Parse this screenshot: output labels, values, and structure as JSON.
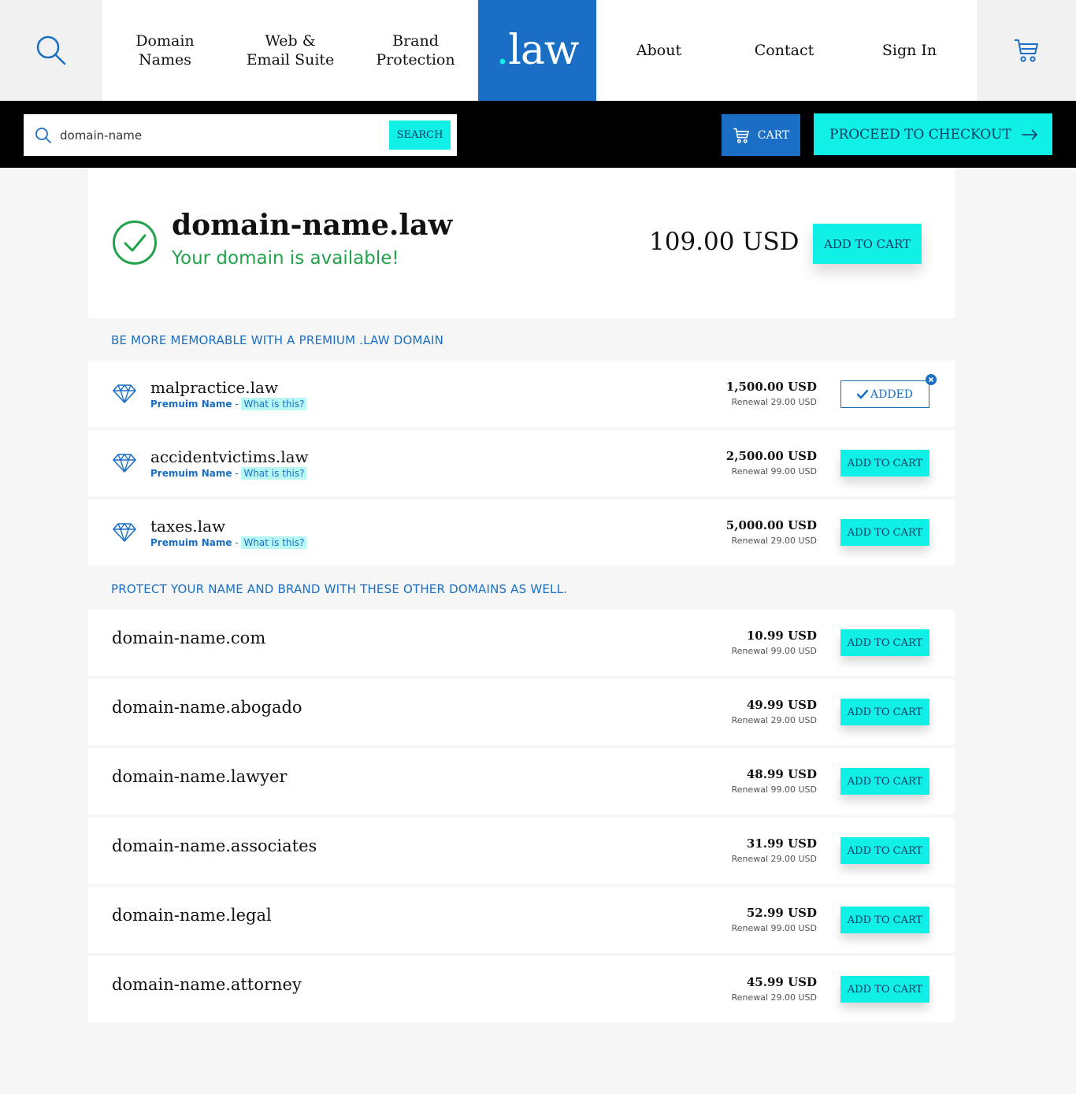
{
  "nav": {
    "items": [
      "Domain\nNames",
      "Web &\nEmail Suite",
      "Brand\nProtection"
    ],
    "logo_dot": ".",
    "logo_text": "law",
    "right_items": [
      "About",
      "Contact",
      "Sign In"
    ]
  },
  "search": {
    "value": "domain-name",
    "button_label": "SEARCH"
  },
  "cart": {
    "label": "CART",
    "checkout_label": "PROCEED TO CHECKOUT"
  },
  "hero": {
    "domain": "domain-name.law",
    "status": "Your domain is available!",
    "price": "109.00 USD",
    "add_label": "ADD TO CART"
  },
  "premium": {
    "heading": "BE MORE MEMORABLE WITH A PREMIUM .LAW DOMAIN",
    "tag_label": "Premuim Name",
    "tag_sep": " - ",
    "tag_link": "What is this?",
    "items": [
      {
        "name": "malpractice.law",
        "price": "1,500.00 USD",
        "renewal": "Renewal 29.00 USD",
        "button": "ADDED"
      },
      {
        "name": "accidentvictims.law",
        "price": "2,500.00 USD",
        "renewal": "Renewal 99.00 USD",
        "button": "ADD TO CART"
      },
      {
        "name": "taxes.law",
        "price": "5,000.00 USD",
        "renewal": "Renewal 29.00 USD",
        "button": "ADD TO CART"
      }
    ]
  },
  "other": {
    "heading": "PROTECT YOUR NAME AND BRAND WITH THESE OTHER DOMAINS AS WELL.",
    "items": [
      {
        "name": "domain-name.com",
        "price": "10.99 USD",
        "renewal": "Renewal 99.00 USD",
        "button": "ADD TO CART"
      },
      {
        "name": "domain-name.abogado",
        "price": "49.99 USD",
        "renewal": "Renewal 29.00 USD",
        "button": "ADD TO CART"
      },
      {
        "name": "domain-name.lawyer",
        "price": "48.99 USD",
        "renewal": "Renewal 99.00 USD",
        "button": "ADD TO CART"
      },
      {
        "name": "domain-name.associates",
        "price": "31.99 USD",
        "renewal": "Renewal 29.00 USD",
        "button": "ADD TO CART"
      },
      {
        "name": "domain-name.legal",
        "price": "52.99 USD",
        "renewal": "Renewal 99.00 USD",
        "button": "ADD TO CART"
      },
      {
        "name": "domain-name.attorney",
        "price": "45.99 USD",
        "renewal": "Renewal 29.00 USD",
        "button": "ADD TO CART"
      }
    ]
  },
  "colors": {
    "primary_blue": "#1a6fc4",
    "accent_cyan": "#10f0e6",
    "success_green": "#22a24a"
  },
  "icons": [
    "search-icon",
    "cart-icon",
    "check-circle-icon",
    "diamond-icon",
    "checkmark-icon",
    "remove-icon",
    "arrow-right-icon"
  ]
}
